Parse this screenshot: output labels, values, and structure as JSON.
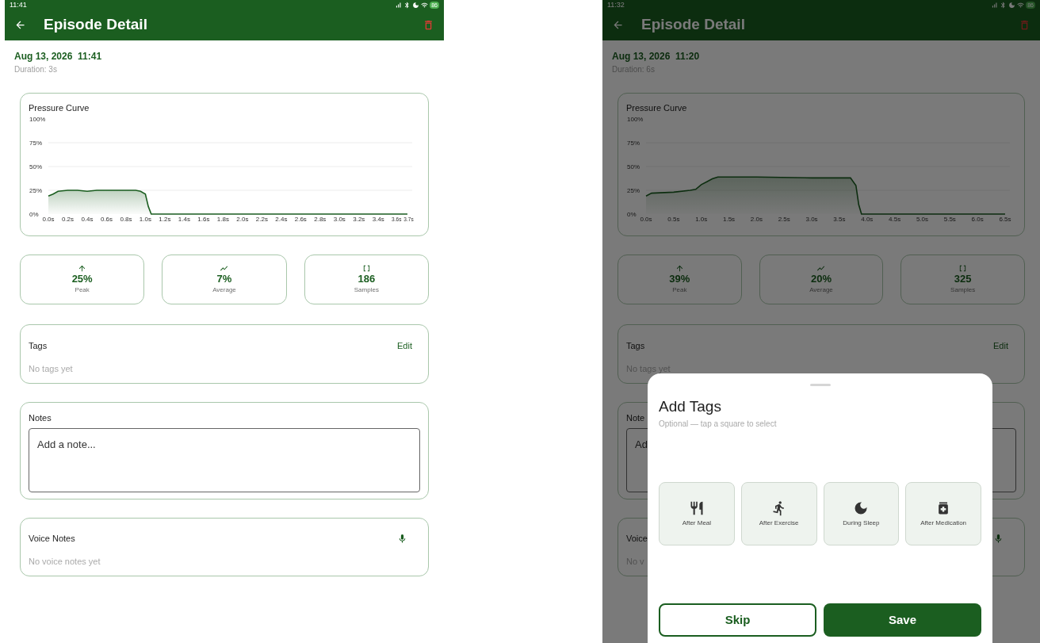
{
  "screens": [
    {
      "status_time": "11:41",
      "battery": "86",
      "title": "Episode Detail",
      "date": "Aug 13, 2026  11:41",
      "duration": "Duration: 3s",
      "chart_data": {
        "type": "line",
        "title": "Pressure Curve",
        "grid": true,
        "xlim": [
          0,
          3.7
        ],
        "ylim": [
          0,
          100
        ],
        "xticks": [
          {
            "value": 0,
            "label": "0.0s"
          },
          {
            "value": 0.2,
            "label": "0.2s"
          },
          {
            "value": 0.4,
            "label": "0.4s"
          },
          {
            "value": 0.6,
            "label": "0.6s"
          },
          {
            "value": 0.8,
            "label": "0.8s"
          },
          {
            "value": 1.0,
            "label": "1.0s"
          },
          {
            "value": 1.2,
            "label": "1.2s"
          },
          {
            "value": 1.4,
            "label": "1.4s"
          },
          {
            "value": 1.6,
            "label": "1.6s"
          },
          {
            "value": 1.8,
            "label": "1.8s"
          },
          {
            "value": 2.0,
            "label": "2.0s"
          },
          {
            "value": 2.2,
            "label": "2.2s"
          },
          {
            "value": 2.4,
            "label": "2.4s"
          },
          {
            "value": 2.6,
            "label": "2.6s"
          },
          {
            "value": 2.8,
            "label": "2.8s"
          },
          {
            "value": 3.0,
            "label": "3.0s"
          },
          {
            "value": 3.2,
            "label": "3.2s"
          },
          {
            "value": 3.4,
            "label": "3.4s"
          },
          {
            "value": 3.6,
            "label": "3.6s"
          },
          {
            "value": 3.7,
            "label": "3.7s"
          }
        ],
        "yticks": [
          {
            "value": 0,
            "label": "0%"
          },
          {
            "value": 25,
            "label": "25%"
          },
          {
            "value": 50,
            "label": "50%"
          },
          {
            "value": 75,
            "label": "75%"
          },
          {
            "value": 100,
            "label": "100%"
          }
        ],
        "x": [
          0,
          0.05,
          0.1,
          0.2,
          0.3,
          0.4,
          0.5,
          0.6,
          0.7,
          0.8,
          0.9,
          0.95,
          1.0,
          1.03,
          1.06,
          1.2,
          2.0,
          3.0,
          3.7
        ],
        "series": [
          {
            "color": "#1b5e20",
            "values": [
              19,
              21,
              24,
              25,
              25,
              24,
              25,
              25,
              25,
              25,
              25,
              24,
              21,
              8,
              0,
              0,
              0,
              0,
              0
            ]
          }
        ]
      },
      "stats": [
        {
          "kind": "peak",
          "value": "25%",
          "label": "Peak"
        },
        {
          "kind": "average",
          "value": "7%",
          "label": "Average"
        },
        {
          "kind": "samples",
          "value": "186",
          "label": "Samples"
        }
      ],
      "tags": {
        "title": "Tags",
        "edit": "Edit",
        "empty": "No tags yet"
      },
      "notes": {
        "title": "Notes",
        "placeholder": "Add a note..."
      },
      "voice": {
        "title": "Voice Notes",
        "empty": "No voice notes yet"
      }
    },
    {
      "status_time": "11:32",
      "battery": "86",
      "title": "Episode Detail",
      "date": "Aug 13, 2026  11:20",
      "duration": "Duration: 6s",
      "chart_data": {
        "type": "line",
        "title": "Pressure Curve",
        "grid": true,
        "xlim": [
          0,
          6.5
        ],
        "ylim": [
          0,
          100
        ],
        "xticks": [
          {
            "value": 0,
            "label": "0.0s"
          },
          {
            "value": 0.5,
            "label": "0.5s"
          },
          {
            "value": 1.0,
            "label": "1.0s"
          },
          {
            "value": 1.5,
            "label": "1.5s"
          },
          {
            "value": 2.0,
            "label": "2.0s"
          },
          {
            "value": 2.5,
            "label": "2.5s"
          },
          {
            "value": 3.0,
            "label": "3.0s"
          },
          {
            "value": 3.5,
            "label": "3.5s"
          },
          {
            "value": 4.0,
            "label": "4.0s"
          },
          {
            "value": 4.5,
            "label": "4.5s"
          },
          {
            "value": 5.0,
            "label": "5.0s"
          },
          {
            "value": 5.5,
            "label": "5.5s"
          },
          {
            "value": 6.0,
            "label": "6.0s"
          },
          {
            "value": 6.5,
            "label": "6.5s"
          }
        ],
        "yticks": [
          {
            "value": 0,
            "label": "0%"
          },
          {
            "value": 25,
            "label": "25%"
          },
          {
            "value": 50,
            "label": "50%"
          },
          {
            "value": 75,
            "label": "75%"
          },
          {
            "value": 100,
            "label": "100%"
          }
        ],
        "x": [
          0,
          0.1,
          0.5,
          0.8,
          0.9,
          1.0,
          1.1,
          1.2,
          1.3,
          1.5,
          2.0,
          3.0,
          3.7,
          3.8,
          3.85,
          3.9,
          5.0,
          6.5
        ],
        "series": [
          {
            "color": "#1b5e20",
            "values": [
              19,
              22,
              23,
              25,
              26,
              31,
              34,
              37,
              39,
              39,
              39,
              38,
              38,
              30,
              10,
              0,
              0,
              0
            ]
          }
        ]
      },
      "stats": [
        {
          "kind": "peak",
          "value": "39%",
          "label": "Peak"
        },
        {
          "kind": "average",
          "value": "20%",
          "label": "Average"
        },
        {
          "kind": "samples",
          "value": "325",
          "label": "Samples"
        }
      ],
      "tags": {
        "title": "Tags",
        "edit": "Edit",
        "empty": "No tags yet"
      },
      "notes": {
        "title": "Note",
        "placeholder": "Ad"
      },
      "voice": {
        "title": "Voice",
        "empty": "No v"
      },
      "sheet": {
        "title": "Add Tags",
        "subtitle": "Optional — tap a square to select",
        "options": [
          {
            "kind": "meal",
            "label": "After Meal",
            "selected": false
          },
          {
            "kind": "exercise",
            "label": "After Exercise",
            "selected": false
          },
          {
            "kind": "sleep",
            "label": "During Sleep",
            "selected": false
          },
          {
            "kind": "medication",
            "label": "After Medication",
            "selected": false
          }
        ],
        "skip": "Skip",
        "save": "Save"
      }
    }
  ]
}
